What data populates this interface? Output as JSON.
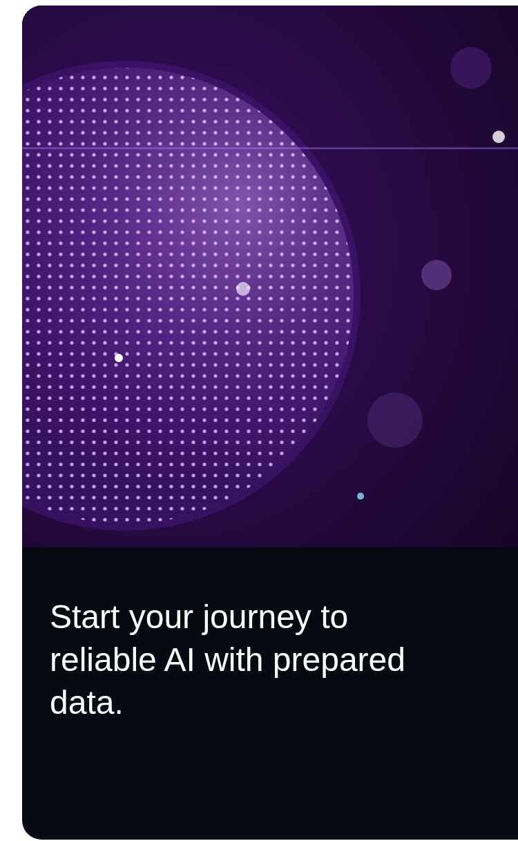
{
  "card": {
    "caption": "Start your journey to reliable AI with prepared data."
  }
}
